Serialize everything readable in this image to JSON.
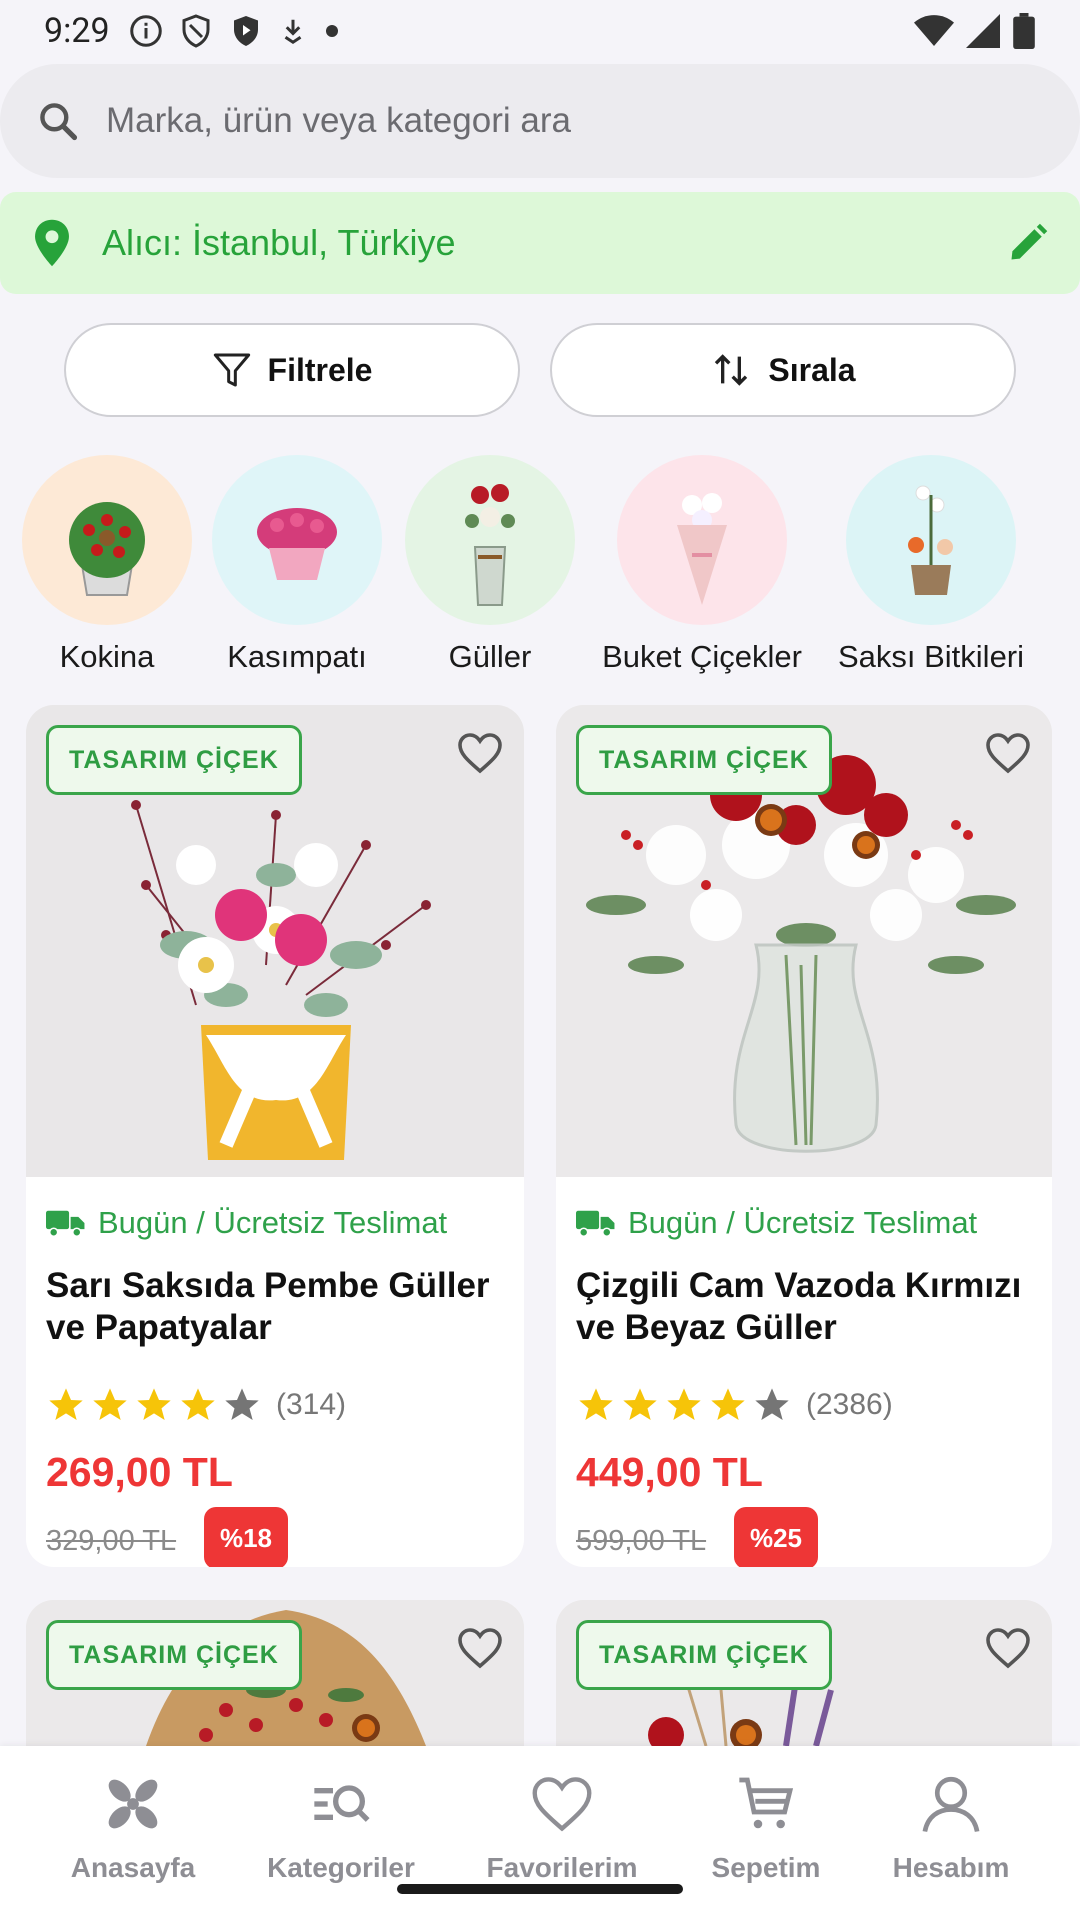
{
  "status_bar": {
    "time": "9:29"
  },
  "search": {
    "placeholder": "Marka, ürün veya kategori ara"
  },
  "recipient": {
    "text": "Alıcı: İstanbul, Türkiye"
  },
  "actions": {
    "filter_label": "Filtrele",
    "sort_label": "Sırala"
  },
  "categories": [
    {
      "label": "Kokina",
      "bg": "#fde9d6"
    },
    {
      "label": "Kasımpatı",
      "bg": "#dff5f8"
    },
    {
      "label": "Güller",
      "bg": "#e4f4e4"
    },
    {
      "label": "Buket Çiçekler",
      "bg": "#fde4ea"
    },
    {
      "label": "Saksı Bitkileri",
      "bg": "#dcf4f6"
    }
  ],
  "products": [
    {
      "badge": "TASARIM ÇİÇEK",
      "delivery": "Bugün / Ücretsiz Teslimat",
      "name": "Sarı Saksıda Pembe Güller ve Papatyalar",
      "rating": 4,
      "reviews": "(314)",
      "price": "269,00 TL",
      "old_price": "329,00 TL",
      "discount": "%18"
    },
    {
      "badge": "TASARIM ÇİÇEK",
      "delivery": "Bugün / Ücretsiz Teslimat",
      "name": "Çizgili Cam Vazoda Kırmızı ve Beyaz Güller",
      "rating": 4,
      "reviews": "(2386)",
      "price": "449,00 TL",
      "old_price": "599,00 TL",
      "discount": "%25"
    },
    {
      "badge": "TASARIM ÇİÇEK"
    },
    {
      "badge": "TASARIM ÇİÇEK"
    }
  ],
  "bottom_nav": [
    {
      "label": "Anasayfa",
      "icon": "home-icon"
    },
    {
      "label": "Kategoriler",
      "icon": "categories-search-icon"
    },
    {
      "label": "Favorilerim",
      "icon": "heart-icon"
    },
    {
      "label": "Sepetim",
      "icon": "cart-icon"
    },
    {
      "label": "Hesabım",
      "icon": "account-icon"
    }
  ],
  "colors": {
    "accent_green": "#2fa14a",
    "price_red": "#ee3636",
    "badge_green": "#3aa54a"
  }
}
